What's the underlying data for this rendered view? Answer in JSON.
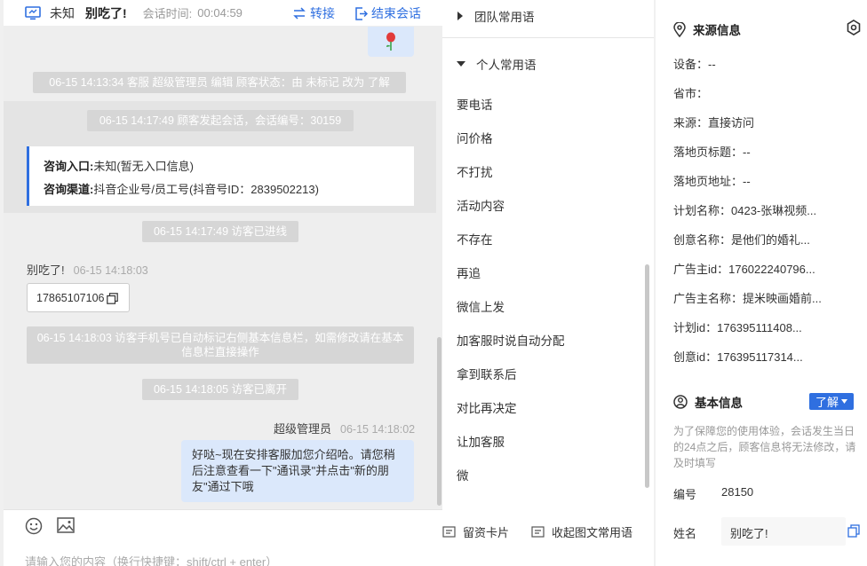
{
  "header": {
    "source": "未知",
    "visitor_name": "别吃了!",
    "duration_label": "会话时间:",
    "duration": "00:04:59",
    "transfer_label": "转接",
    "end_label": "结束会话"
  },
  "chat": {
    "sys1": "06-15 14:13:34 客服 超级管理员 编辑 顾客状态：由 未标记 改为 了解",
    "sys2": "06-15 14:17:49 顾客发起会话，会话编号：30159",
    "entry_label": "咨询入口:",
    "entry_value": "未知(暂无入口信息)",
    "channel_label": "咨询渠道:",
    "channel_value": "抖音企业号/员工号(抖音号ID：2839502213)",
    "sys3": "06-15 14:17:49 访客已进线",
    "visitor_msg_name": "别吃了!",
    "visitor_msg_time": "06-15 14:18:03",
    "phone": "17865107106",
    "sys4": "06-15 14:18:03 访客手机号已自动标记右侧基本信息栏，如需修改请在基本信息栏直接操作",
    "sys5": "06-15 14:18:05 访客已离开",
    "agent_name": "超级管理员",
    "agent_time": "06-15 14:18:02",
    "agent_msg": "好哒~现在安排客服加您介绍哈。请您稍后注意查看一下\"通讯录\"并点击\"新的朋友\"通过下哦",
    "input_placeholder": "请输入您的内容（换行快捷键：shift/ctrl + enter）",
    "emoji_icon": "smile-icon",
    "image_icon": "image-icon"
  },
  "phrases": {
    "team_group": "团队常用语",
    "personal_group": "个人常用语",
    "items": [
      "要电话",
      "问价格",
      "不打扰",
      "活动内容",
      "不存在",
      "再追",
      "微信上发",
      "加客服时说自动分配",
      "拿到联系后",
      "对比再决定",
      "让加客服",
      "微"
    ],
    "card_btn": "留资卡片",
    "collapse_btn": "收起图文常用语"
  },
  "sidebar": {
    "source_title": "来源信息",
    "device": "设备：--",
    "province": "省市：",
    "origin": "来源：直接访问",
    "landing_title": "落地页标题：--",
    "landing_url": "落地页地址：--",
    "plan_name": "计划名称：0423-张琳视频...",
    "creative_name": "创意名称：是他们的婚礼...",
    "advertiser_id": "广告主id：176022240796...",
    "advertiser_name": "广告主名称：提米映画婚前...",
    "plan_id": "计划id：176395111408...",
    "creative_id": "创意id：176395117314...",
    "basic_title": "基本信息",
    "status_tag": "了解",
    "note": "为了保障您的使用体验，会话发生当日的24点之后，顾客信息将无法修改，请及时填写",
    "number_label": "编号",
    "number_value": "28150",
    "name_label": "姓名",
    "name_value": "别吃了!"
  },
  "colors": {
    "accent": "#2f6fe0",
    "system_msg": "#d6d6d6",
    "agent_bubble": "#dbe8fb"
  }
}
